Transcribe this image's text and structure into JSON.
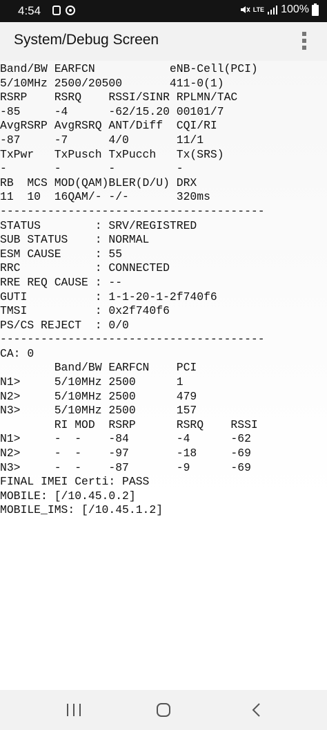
{
  "status_bar": {
    "time": "4:54",
    "network": "LTE",
    "battery": "100%"
  },
  "app_bar": {
    "title": "System/Debug Screen"
  },
  "debug_lines": [
    "Band/BW EARFCN           eNB-Cell(PCI)",
    "5/10MHz 2500/20500       411-0(1)",
    "RSRP    RSRQ    RSSI/SINR RPLMN/TAC",
    "-85     -4      -62/15.20 00101/7",
    "AvgRSRP AvgRSRQ ANT/Diff  CQI/RI",
    "-87     -7      4/0       11/1",
    "TxPwr   TxPusch TxPucch   Tx(SRS)",
    "-       -       -         -",
    "RB  MCS MOD(QAM)BLER(D/U) DRX",
    "11  10  16QAM/- -/-       320ms",
    "---------------------------------------",
    "STATUS        : SRV/REGISTRED",
    "SUB STATUS    : NORMAL",
    "ESM CAUSE     : 55",
    "RRC           : CONNECTED",
    "RRE REQ CAUSE : --",
    "GUTI          : 1-1-20-1-2f740f6",
    "TMSI          : 0x2f740f6",
    "PS/CS REJECT  : 0/0",
    "---------------------------------------",
    "CA: 0",
    "        Band/BW EARFCN    PCI",
    "N1>     5/10MHz 2500      1",
    "N2>     5/10MHz 2500      479",
    "N3>     5/10MHz 2500      157",
    "        RI MOD  RSRP      RSRQ    RSSI",
    "N1>     -  -    -84       -4      -62",
    "N2>     -  -    -97       -18     -69",
    "N3>     -  -    -87       -9      -69",
    "FINAL IMEI Certi: PASS",
    "MOBILE: [/10.45.0.2]",
    "MOBILE_IMS: [/10.45.1.2]"
  ],
  "icons": {
    "overflow": "more-vert-icon",
    "recents": "recents-icon",
    "home": "home-icon",
    "back": "back-icon",
    "mute": "mute-icon",
    "signal": "signal-icon",
    "battery": "battery-icon",
    "notification_a": "notification-icon",
    "notification_b": "notification-icon"
  }
}
